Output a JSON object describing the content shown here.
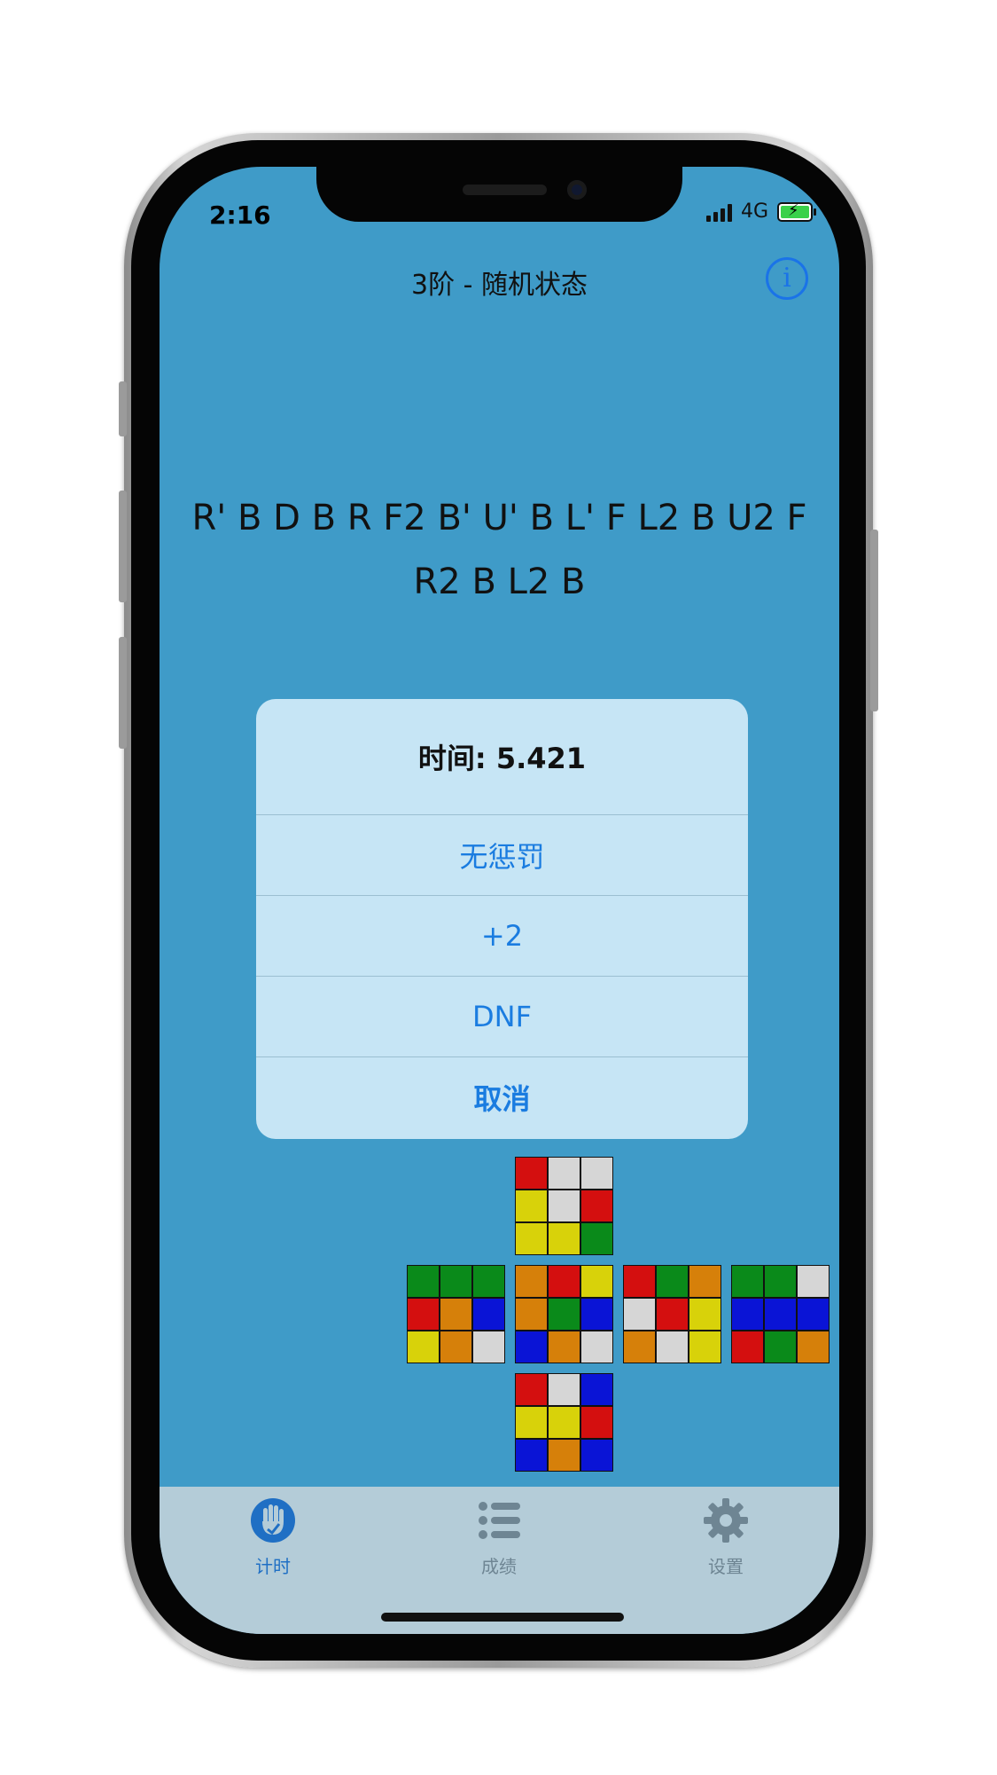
{
  "status_bar": {
    "time": "2:16",
    "network": "4G"
  },
  "nav": {
    "title": "3阶 - 随机状态",
    "info_icon": "info-icon"
  },
  "scramble": "R' B D B R F2 B' U' B L' F L2 B U2 F R2 B L2 B",
  "alert": {
    "title": "时间: 5.421",
    "actions": [
      "无惩罚",
      "+2",
      "DNF",
      "取消"
    ]
  },
  "colors": {
    "background": "#3f9bc8",
    "accent": "#1a7ce0",
    "tab_active": "#1f6fc4",
    "tab_inactive": "#6e8593"
  },
  "cube_net": {
    "U": [
      "r",
      "w",
      "w",
      "y",
      "w",
      "r",
      "y",
      "y",
      "g"
    ],
    "L": [
      "g",
      "g",
      "g",
      "r",
      "o",
      "b",
      "y",
      "o",
      "w"
    ],
    "F": [
      "o",
      "r",
      "y",
      "o",
      "g",
      "b",
      "b",
      "o",
      "w"
    ],
    "R": [
      "r",
      "g",
      "o",
      "w",
      "r",
      "y",
      "o",
      "w",
      "y"
    ],
    "B": [
      "g",
      "g",
      "w",
      "b",
      "b",
      "b",
      "r",
      "g",
      "o"
    ],
    "D": [
      "r",
      "w",
      "b",
      "y",
      "y",
      "r",
      "b",
      "o",
      "b"
    ]
  },
  "tabs": [
    {
      "label": "计时",
      "icon": "timer-hand-icon",
      "active": true
    },
    {
      "label": "成绩",
      "icon": "list-icon",
      "active": false
    },
    {
      "label": "设置",
      "icon": "gear-icon",
      "active": false
    }
  ]
}
